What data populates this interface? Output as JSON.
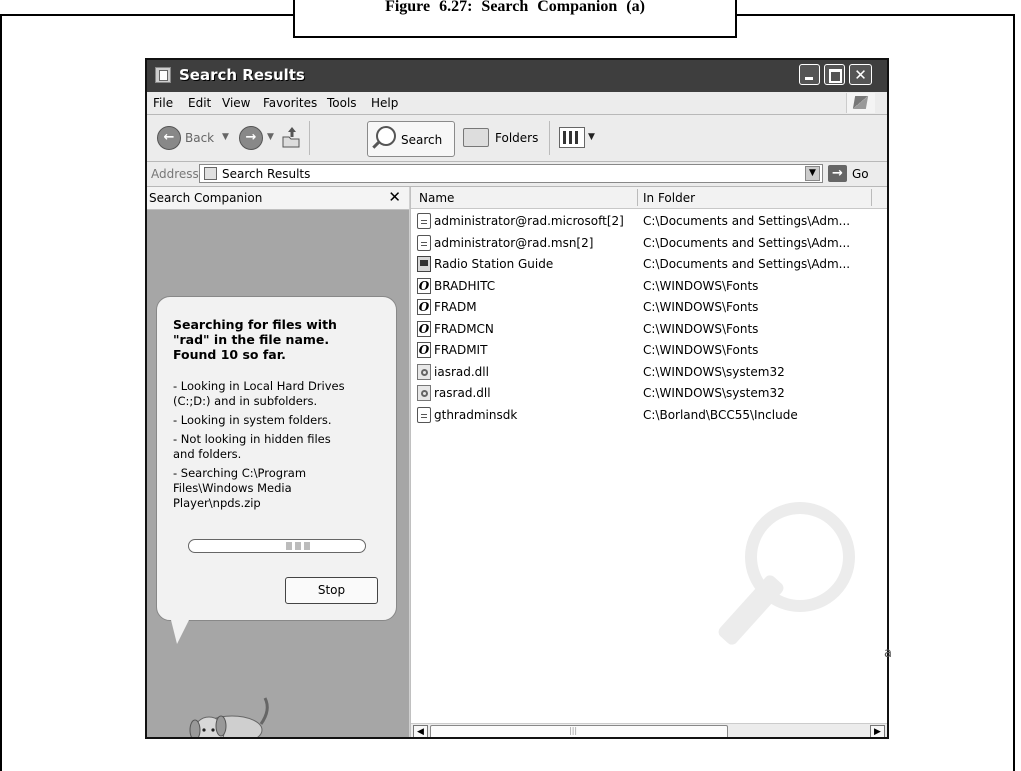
{
  "caption": "Figure 6.27: Search Companion (a)",
  "window": {
    "title": "Search Results"
  },
  "menu": [
    "File",
    "Edit",
    "View",
    "Favorites",
    "Tools",
    "Help"
  ],
  "toolbar": {
    "back": "Back",
    "search": "Search",
    "folders": "Folders"
  },
  "address": {
    "label": "Address",
    "value": "Search Results",
    "go": "Go"
  },
  "search_pane": {
    "title": "Search Companion",
    "heading": "Searching for files with\n\"rad\" in the file name.\nFound 10 so far.",
    "items": [
      "- Looking in Local Hard Drives\n(C:;D:) and in subfolders.",
      "- Looking in system folders.",
      "- Not looking in hidden files\nand folders.",
      "- Searching C:\\Program\nFiles\\Windows Media\nPlayer\\npds.zip"
    ],
    "stop": "Stop"
  },
  "columns": [
    "Name",
    "In Folder"
  ],
  "files": [
    {
      "name": "administrator@rad.microsoft[2]",
      "folder": "C:\\Documents and Settings\\Adm...",
      "icon": "doc"
    },
    {
      "name": "administrator@rad.msn[2]",
      "folder": "C:\\Documents and Settings\\Adm...",
      "icon": "doc"
    },
    {
      "name": "Radio Station Guide",
      "folder": "C:\\Documents and Settings\\Adm...",
      "icon": "radio"
    },
    {
      "name": "BRADHITC",
      "folder": "C:\\WINDOWS\\Fonts",
      "icon": "font"
    },
    {
      "name": "FRADM",
      "folder": "C:\\WINDOWS\\Fonts",
      "icon": "font"
    },
    {
      "name": "FRADMCN",
      "folder": "C:\\WINDOWS\\Fonts",
      "icon": "font"
    },
    {
      "name": "FRADMIT",
      "folder": "C:\\WINDOWS\\Fonts",
      "icon": "font"
    },
    {
      "name": "iasrad.dll",
      "folder": "C:\\WINDOWS\\system32",
      "icon": "dll"
    },
    {
      "name": "rasrad.dll",
      "folder": "C:\\WINDOWS\\system32",
      "icon": "dll"
    },
    {
      "name": "gthradminsdk",
      "folder": "C:\\Borland\\BCC55\\Include",
      "icon": "doc"
    }
  ],
  "side_char": "a"
}
